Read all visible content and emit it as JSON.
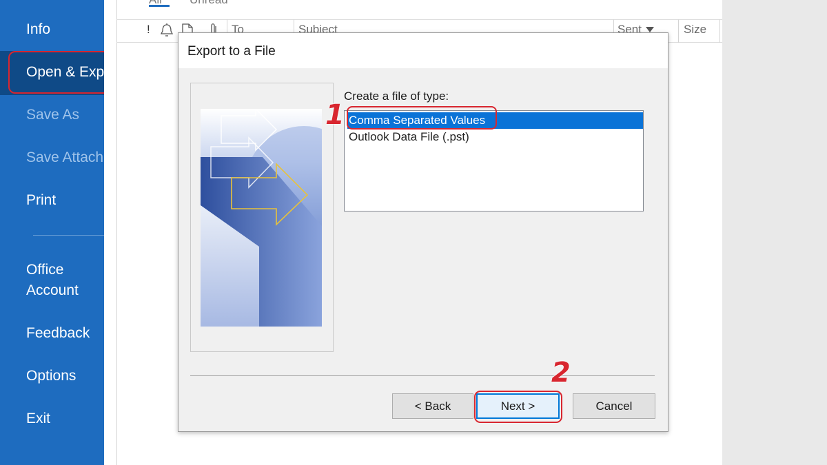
{
  "sidebar": {
    "items": [
      {
        "label": "Info"
      },
      {
        "label": "Open & Exp"
      },
      {
        "label": "Save As"
      },
      {
        "label": "Save Attach"
      },
      {
        "label": "Print"
      },
      {
        "label": "Office"
      },
      {
        "label": "Account"
      },
      {
        "label": "Feedback"
      },
      {
        "label": "Options"
      },
      {
        "label": "Exit"
      }
    ]
  },
  "mail_list": {
    "tabs": [
      "All",
      "Unread"
    ],
    "columns": [
      "!",
      "To",
      "Subject",
      "Sent",
      "Size"
    ],
    "sort_icon": "triangle-down-icon"
  },
  "dialog": {
    "title": "Export to a File",
    "file_type_label": "Create a file of type:",
    "options": [
      {
        "label": "Comma Separated Values",
        "selected": true
      },
      {
        "label": "Outlook Data File (.pst)",
        "selected": false
      }
    ],
    "buttons": {
      "back": "< Back",
      "next": "Next >",
      "cancel": "Cancel"
    }
  },
  "annotations": {
    "step1": "1",
    "step2": "2"
  },
  "colors": {
    "sidebar": "#1e6cbf",
    "sidebar_selected": "#0f4a87",
    "selection": "#0a73d7",
    "highlight": "#d8262f"
  }
}
